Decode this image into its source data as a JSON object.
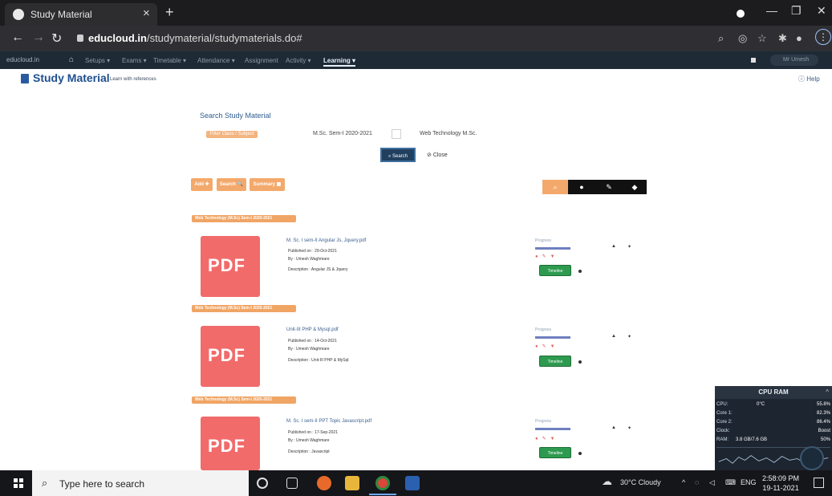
{
  "browser": {
    "tab_title": "Study Material",
    "tab_close": "×",
    "new_tab": "+",
    "window_controls": [
      "—",
      "❐",
      "✕"
    ],
    "url_host": "educloud.in",
    "url_path": "/studymaterial/studymaterials.do#",
    "menu": "⋮"
  },
  "site_nav": {
    "brand": "educloud.in",
    "items": [
      "Setups ▾",
      "Exams ▾",
      "Timetable ▾",
      "Attendance ▾",
      "Assignment",
      "Activity ▾",
      "Learning ▾"
    ],
    "active_index": 6,
    "user": "Mr Umesh"
  },
  "page": {
    "title": "Study Material",
    "subtitle": "Learn with references",
    "help": "Help"
  },
  "search": {
    "title": "Search Study Material",
    "select_tag": "Filter Class / Subject",
    "class_value": "M.Sc. Sem-I  2020-2021",
    "subject_value": "Web Technology M.Sc.",
    "search_btn": "Search",
    "close_btn": "Close"
  },
  "actions": {
    "add": "Add ✚",
    "search": "Search 🔍",
    "summary": "Summary ▦"
  },
  "materials": [
    {
      "section": "Web Technology (M.Sc) Sem-I 2020-2021",
      "title": "M. Sc. I sem-II Angular Js, Jquery.pdf",
      "published": "Published on : 29-Oct-2021",
      "by": "By : Umesh Waghmare",
      "description": "Description : Angular JS & Jquery",
      "progress_label": "Progress",
      "button": "Timeline"
    },
    {
      "section": "Web Technology (M.Sc) Sem-I 2020-2021",
      "title": "Unit-III PHP & Mysql.pdf",
      "published": "Published on : 14-Oct-2021",
      "by": "By : Umesh Waghmare",
      "description": "Description : Unit-III PHP & MySql",
      "progress_label": "Progress",
      "button": "Timeline"
    },
    {
      "section": "Web Technology (M.Sc) Sem-I 2020-2021",
      "title": "M. Sc. I sem-II PPT Topic Javascript.pdf",
      "published": "Published on : 17-Sep-2021",
      "by": "By : Umesh Waghmare",
      "description": "Description : Javascript",
      "progress_label": "Progress",
      "button": "Timeline"
    }
  ],
  "pdf_label": "PDF",
  "cpu_widget": {
    "header": "CPU RAM",
    "rows": [
      {
        "label": "CPU:",
        "mid": "0°C",
        "value": "55.8%"
      },
      {
        "label": "Core 1:",
        "mid": "",
        "value": "82.3%"
      },
      {
        "label": "Core 2:",
        "mid": "",
        "value": "86.4%"
      },
      {
        "label": "Clock:",
        "mid": "",
        "value": "Boost"
      },
      {
        "label": "RAM:",
        "mid": "3.8 GB/7.6 GB",
        "value": "50%"
      }
    ]
  },
  "taskbar": {
    "search_placeholder": "Type here to search",
    "weather": "30°C  Cloudy",
    "lang": "ENG",
    "time": "2:58:09 PM",
    "date": "19-11-2021"
  },
  "colors": {
    "accent_orange": "#f3a96b",
    "pdf_red": "#f16b6b",
    "green_button": "#2e9a4f",
    "title_blue": "#1f4f8f"
  }
}
